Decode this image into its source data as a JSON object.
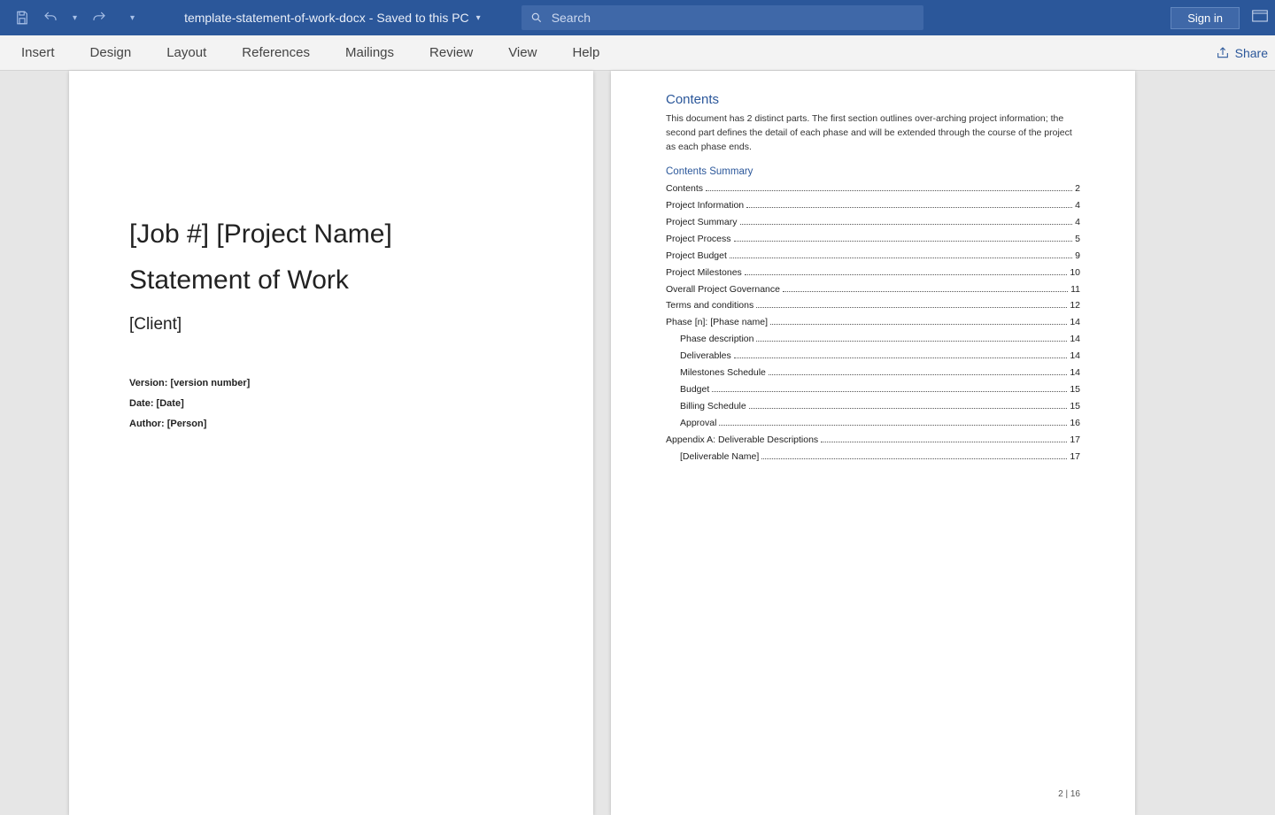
{
  "titlebar": {
    "filename": "template-statement-of-work-docx",
    "save_state": "Saved to this PC",
    "search_placeholder": "Search",
    "sign_in": "Sign in"
  },
  "ribbon": {
    "tabs": [
      "Insert",
      "Design",
      "Layout",
      "References",
      "Mailings",
      "Review",
      "View",
      "Help"
    ],
    "share": "Share"
  },
  "page1": {
    "title1": "[Job #] [Project Name]",
    "title2": "Statement of Work",
    "client": "[Client]",
    "version": "Version: [version number]",
    "date": "Date: [Date]",
    "author": "Author: [Person]"
  },
  "page2": {
    "contents_heading": "Contents",
    "contents_desc": "This document has 2 distinct parts. The first section outlines over-arching project information; the second part defines the detail of each phase and will be extended through the course of the project as each phase ends.",
    "summary_heading": "Contents Summary",
    "toc": [
      {
        "label": "Contents",
        "page": "2",
        "indent": false
      },
      {
        "label": "Project Information",
        "page": "4",
        "indent": false
      },
      {
        "label": "Project Summary",
        "page": "4",
        "indent": false
      },
      {
        "label": "Project Process",
        "page": "5",
        "indent": false
      },
      {
        "label": "Project Budget",
        "page": "9",
        "indent": false
      },
      {
        "label": "Project Milestones",
        "page": "10",
        "indent": false
      },
      {
        "label": "Overall Project Governance",
        "page": "11",
        "indent": false
      },
      {
        "label": "Terms and conditions",
        "page": "12",
        "indent": false
      },
      {
        "label": "Phase [n]:  [Phase name]",
        "page": "14",
        "indent": false
      },
      {
        "label": "Phase description",
        "page": "14",
        "indent": true
      },
      {
        "label": "Deliverables",
        "page": "14",
        "indent": true
      },
      {
        "label": "Milestones Schedule",
        "page": "14",
        "indent": true
      },
      {
        "label": "Budget",
        "page": "15",
        "indent": true
      },
      {
        "label": "Billing Schedule",
        "page": "15",
        "indent": true
      },
      {
        "label": "Approval",
        "page": "16",
        "indent": true
      },
      {
        "label": "Appendix A: Deliverable Descriptions",
        "page": "17",
        "indent": false
      },
      {
        "label": "[Deliverable Name]",
        "page": "17",
        "indent": true
      }
    ],
    "page_number": "2 | 16"
  }
}
